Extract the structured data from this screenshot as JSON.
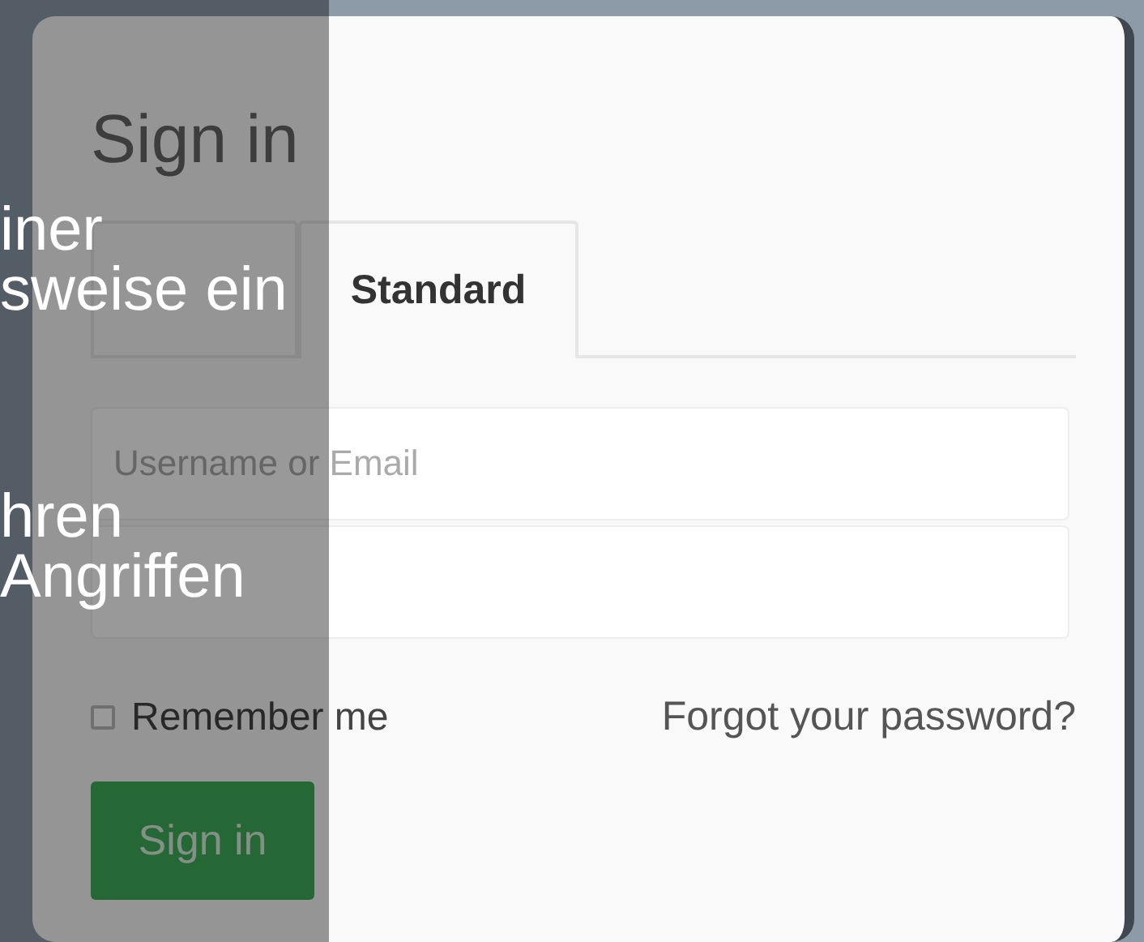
{
  "card": {
    "title": "Sign in",
    "tabs": [
      {
        "selected": false
      },
      {
        "label": "Standard",
        "selected": true
      }
    ],
    "username_field": {
      "placeholder": "Username or Email"
    },
    "remember": {
      "label": "Remember me",
      "checked": false
    },
    "forgot_link": "Forgot your password?",
    "submit": "Sign in"
  },
  "overlay": {
    "lines": [
      "iner",
      "sweise ein",
      "hren",
      "Angriffen"
    ]
  }
}
